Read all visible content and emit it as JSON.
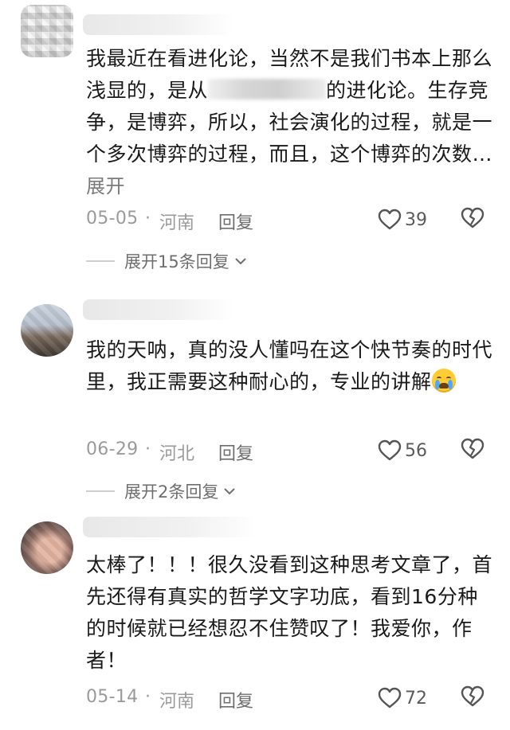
{
  "comments": [
    {
      "text_part1": "我最近在看进化论，当然不是我们书本上那么浅显的，是从",
      "text_part2": "的进化论。生存竞争，是博弈，所以，社会演化的过程，就是一个多次博弈的过程，而且，这个博弈的次数…",
      "expand_label": "展开",
      "date": "05-05",
      "separator": "·",
      "region": "河南",
      "reply_label": "回复",
      "likes": "39",
      "replies_label": "展开15条回复"
    },
    {
      "text": "我的天呐，真的没人懂吗在这个快节奏的时代里，我正需要这种耐心的，专业的讲解",
      "emoji": "crying-face-emoji",
      "date": "06-29",
      "separator": "·",
      "region": "河北",
      "reply_label": "回复",
      "likes": "56",
      "replies_label": "展开2条回复"
    },
    {
      "text": "太棒了！！！很久没看到这种思考文章了，首先还得有真实的哲学文字功底，看到16分种的时候就已经想忍不住赞叹了！我爱你，作者！",
      "date": "05-14",
      "separator": "·",
      "region": "河南",
      "reply_label": "回复",
      "likes": "72"
    }
  ],
  "icons": {
    "like": "heart-outline-icon",
    "dislike": "broken-heart-icon",
    "expand": "chevron-down-icon"
  },
  "colors": {
    "text": "#1a1a1a",
    "meta": "#9a9a9a",
    "icon_stroke": "#555555"
  }
}
